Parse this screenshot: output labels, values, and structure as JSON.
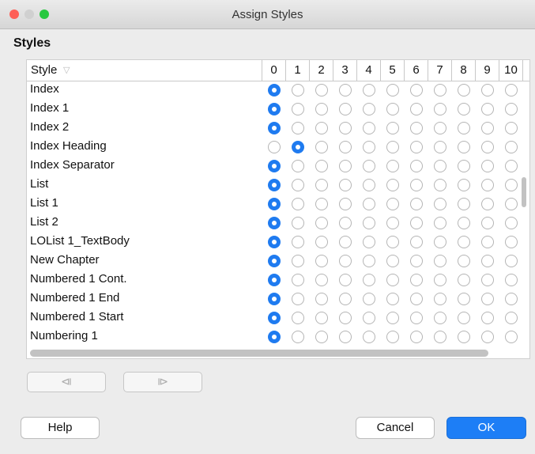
{
  "window": {
    "title": "Assign Styles",
    "section_title": "Styles"
  },
  "grid": {
    "style_header": "Style",
    "filter_icon": "filter-icon",
    "columns": [
      "0",
      "1",
      "2",
      "3",
      "4",
      "5",
      "6",
      "7",
      "8",
      "9",
      "10"
    ],
    "rows": [
      {
        "label": "Index",
        "level": 0
      },
      {
        "label": "Index 1",
        "level": 0
      },
      {
        "label": "Index 2",
        "level": 0
      },
      {
        "label": "Index Heading",
        "level": 1
      },
      {
        "label": "Index Separator",
        "level": 0
      },
      {
        "label": "List",
        "level": 0
      },
      {
        "label": "List 1",
        "level": 0
      },
      {
        "label": "List 2",
        "level": 0
      },
      {
        "label": "LOList 1_TextBody",
        "level": 0
      },
      {
        "label": "New Chapter",
        "level": 0
      },
      {
        "label": "Numbered 1 Cont.",
        "level": 0
      },
      {
        "label": "Numbered 1 End",
        "level": 0
      },
      {
        "label": "Numbered 1 Start",
        "level": 0
      },
      {
        "label": "Numbering 1",
        "level": 0
      }
    ]
  },
  "nav": {
    "prev_icon": "⧏",
    "next_icon": "⧐"
  },
  "buttons": {
    "help": "Help",
    "cancel": "Cancel",
    "ok": "OK"
  },
  "colors": {
    "accent": "#1f7bf0",
    "close": "#fe5f57",
    "minimize": "#d0d0d0",
    "zoom": "#28c840"
  }
}
